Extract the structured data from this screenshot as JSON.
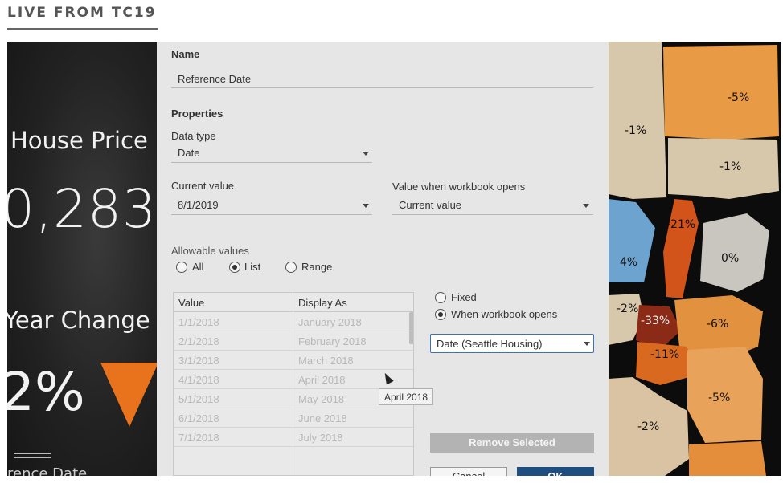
{
  "header": {
    "title": "LIVE FROM TC19"
  },
  "dashboard": {
    "house_price_label": "House Price",
    "price_value": "0,283",
    "year_change_label": "Year Change",
    "change_value": "2%",
    "date_label": "rence Date",
    "accent_color": "#e8731c"
  },
  "dialog": {
    "name_label": "Name",
    "name_value": "Reference Date",
    "properties_label": "Properties",
    "data_type_label": "Data type",
    "data_type_value": "Date",
    "current_value_label": "Current value",
    "current_value": "8/1/2019",
    "workbook_opens_label": "Value when workbook opens",
    "workbook_opens_value": "Current value",
    "allowable_label": "Allowable values",
    "allowable_options": [
      "All",
      "List",
      "Range"
    ],
    "allowable_selected": "List",
    "table": {
      "headers": [
        "Value",
        "Display As"
      ],
      "rows": [
        [
          "1/1/2018",
          "January 2018"
        ],
        [
          "2/1/2018",
          "February 2018"
        ],
        [
          "3/1/2018",
          "March 2018"
        ],
        [
          "4/1/2018",
          "April 2018"
        ],
        [
          "5/1/2018",
          "May 2018"
        ],
        [
          "6/1/2018",
          "June 2018"
        ],
        [
          "7/1/2018",
          "July 2018"
        ]
      ]
    },
    "fixed_label": "Fixed",
    "when_opens_label": "When workbook opens",
    "when_opens_selected": true,
    "source_select_value": "Date (Seattle Housing)",
    "tooltip_text": "April 2018",
    "remove_button": "Remove Selected",
    "cancel_button": "Cancel",
    "ok_button": "OK",
    "ok_color": "#1f4f80"
  },
  "map": {
    "labels": [
      "-5%",
      "-1%",
      "-1%",
      "-21%",
      "4%",
      "0%",
      "-2%",
      "-33%",
      "-6%",
      "-11%",
      "-5%",
      "-2%"
    ]
  }
}
